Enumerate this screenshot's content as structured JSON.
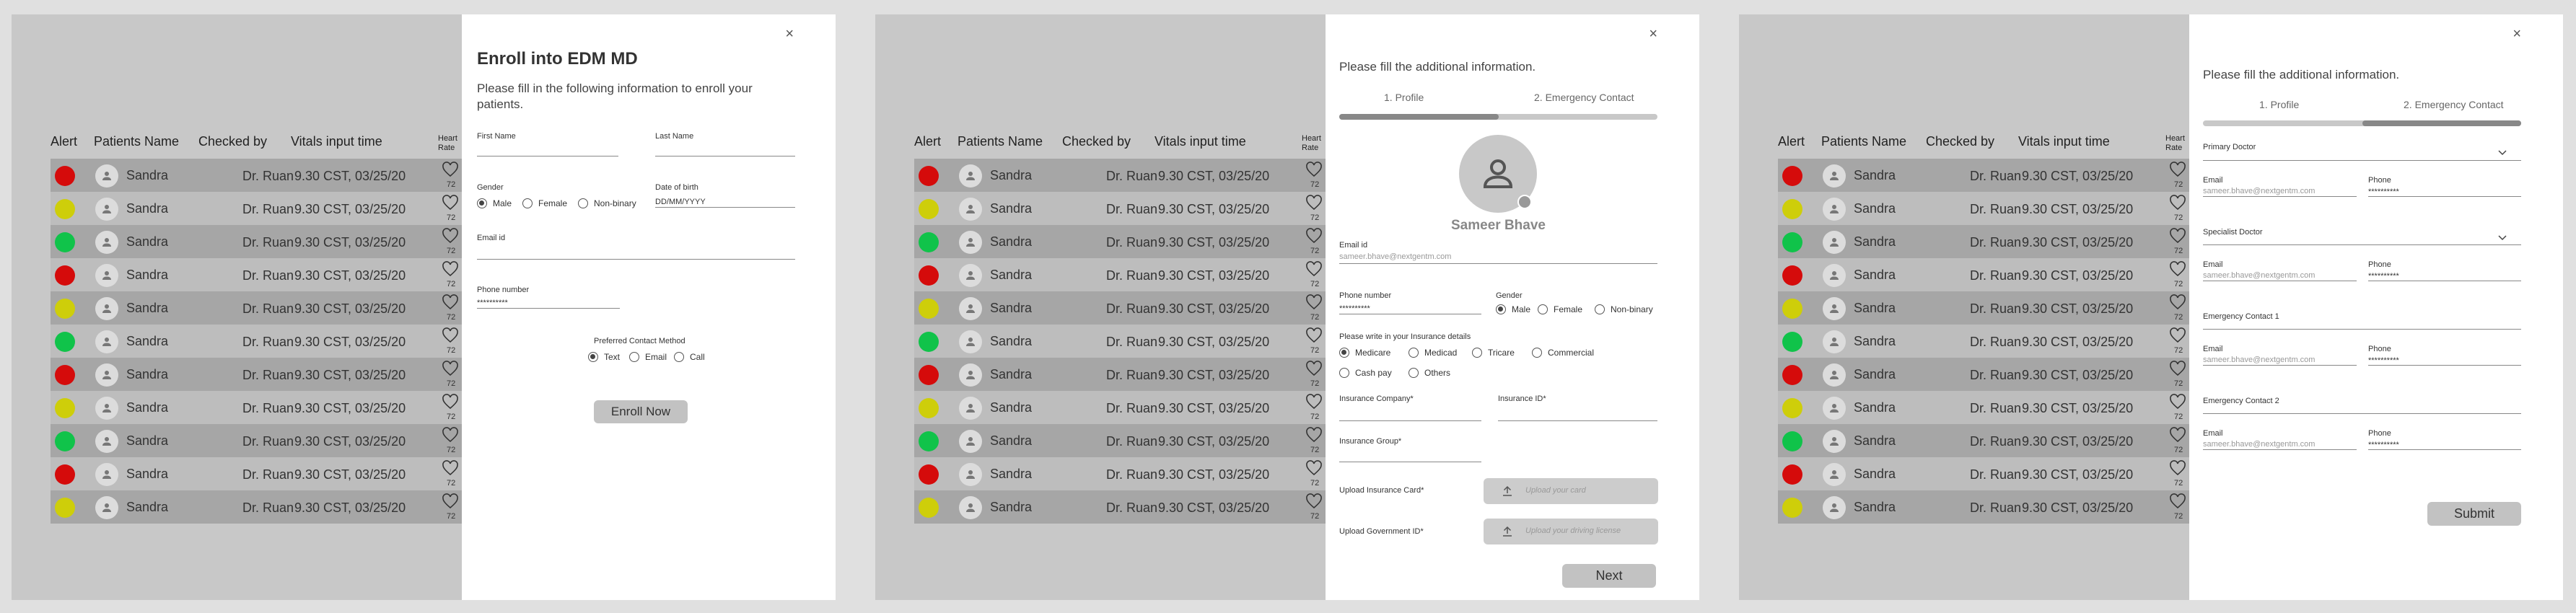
{
  "table": {
    "headers": {
      "alert": "Alert",
      "name": "Patients Name",
      "checked": "Checked by",
      "vitals": "Vitals input time",
      "heart": "Heart Rate"
    },
    "rows": [
      {
        "alert": "red",
        "name": "Sandra",
        "checked": "Dr. Ruan",
        "vitals": "9.30 CST, 03/25/20",
        "heart": "72"
      },
      {
        "alert": "yellow",
        "name": "Sandra",
        "checked": "Dr. Ruan",
        "vitals": "9.30 CST, 03/25/20",
        "heart": "72"
      },
      {
        "alert": "green",
        "name": "Sandra",
        "checked": "Dr. Ruan",
        "vitals": "9.30 CST, 03/25/20",
        "heart": "72"
      },
      {
        "alert": "red",
        "name": "Sandra",
        "checked": "Dr. Ruan",
        "vitals": "9.30 CST, 03/25/20",
        "heart": "72"
      },
      {
        "alert": "yellow",
        "name": "Sandra",
        "checked": "Dr. Ruan",
        "vitals": "9.30 CST, 03/25/20",
        "heart": "72"
      },
      {
        "alert": "green",
        "name": "Sandra",
        "checked": "Dr. Ruan",
        "vitals": "9.30 CST, 03/25/20",
        "heart": "72"
      },
      {
        "alert": "red",
        "name": "Sandra",
        "checked": "Dr. Ruan",
        "vitals": "9.30 CST, 03/25/20",
        "heart": "72"
      },
      {
        "alert": "yellow",
        "name": "Sandra",
        "checked": "Dr. Ruan",
        "vitals": "9.30 CST, 03/25/20",
        "heart": "72"
      },
      {
        "alert": "green",
        "name": "Sandra",
        "checked": "Dr. Ruan",
        "vitals": "9.30 CST, 03/25/20",
        "heart": "72"
      },
      {
        "alert": "red",
        "name": "Sandra",
        "checked": "Dr. Ruan",
        "vitals": "9.30 CST, 03/25/20",
        "heart": "72"
      },
      {
        "alert": "yellow",
        "name": "Sandra",
        "checked": "Dr. Ruan",
        "vitals": "9.30 CST, 03/25/20",
        "heart": "72"
      }
    ]
  },
  "colors": {
    "red": "#d50b0b",
    "yellow": "#cece0a",
    "green": "#10c34a"
  },
  "enroll": {
    "close": "×",
    "title": "Enroll into EDM MD",
    "subtitle": "Please fill in the following information to enroll your patients.",
    "first_name": "First Name",
    "last_name": "Last Name",
    "gender": "Gender",
    "gender_options": [
      "Male",
      "Female",
      "Non-binary"
    ],
    "dob": "Date of birth",
    "dob_placeholder": "DD/MM/YYYY",
    "email": "Email id",
    "phone": "Phone number",
    "phone_value": "**********",
    "contact_method": "Preferred Contact Method",
    "contact_options": [
      "Text",
      "Email",
      "Call"
    ],
    "submit": "Enroll Now"
  },
  "profile": {
    "close": "×",
    "subtitle": "Please fill the additional information.",
    "tabs": [
      "1. Profile",
      "2. Emergency Contact"
    ],
    "active_tab_fraction": 0.5,
    "patient_name": "Sameer Bhave",
    "email": "Email id",
    "email_value": "sameer.bhave@nextgentm.com",
    "phone": "Phone number",
    "phone_value": "**********",
    "gender": "Gender",
    "gender_options": [
      "Male",
      "Female",
      "Non-binary"
    ],
    "insurance_prompt": "Please write in your Insurance details",
    "insurance_options": [
      "Medicare",
      "Medicad",
      "Tricare",
      "Commercial",
      "Cash pay",
      "Others"
    ],
    "insurance_company": "Insurance Company*",
    "insurance_id": "Insurance ID*",
    "insurance_group": "Insurance Group*",
    "upload_card": "Upload Insurance Card*",
    "upload_card_placeholder": "Upload your card",
    "upload_gov": "Upload Government ID*",
    "upload_gov_placeholder": "Upload your driving license",
    "next": "Next"
  },
  "emergency": {
    "close": "×",
    "subtitle": "Please fill the additional information.",
    "tabs": [
      "1. Profile",
      "2. Emergency Contact"
    ],
    "active_tab_fraction": 1.0,
    "primary_doctor": "Primary Doctor",
    "specialist_doctor": "Specialist Doctor",
    "emergency_1": "Emergency Contact 1",
    "emergency_2": "Emergency Contact 2",
    "email": "Email",
    "phone": "Phone",
    "email_value": "sameer.bhave@nextgentm.com",
    "phone_value": "**********",
    "submit": "Submit"
  }
}
